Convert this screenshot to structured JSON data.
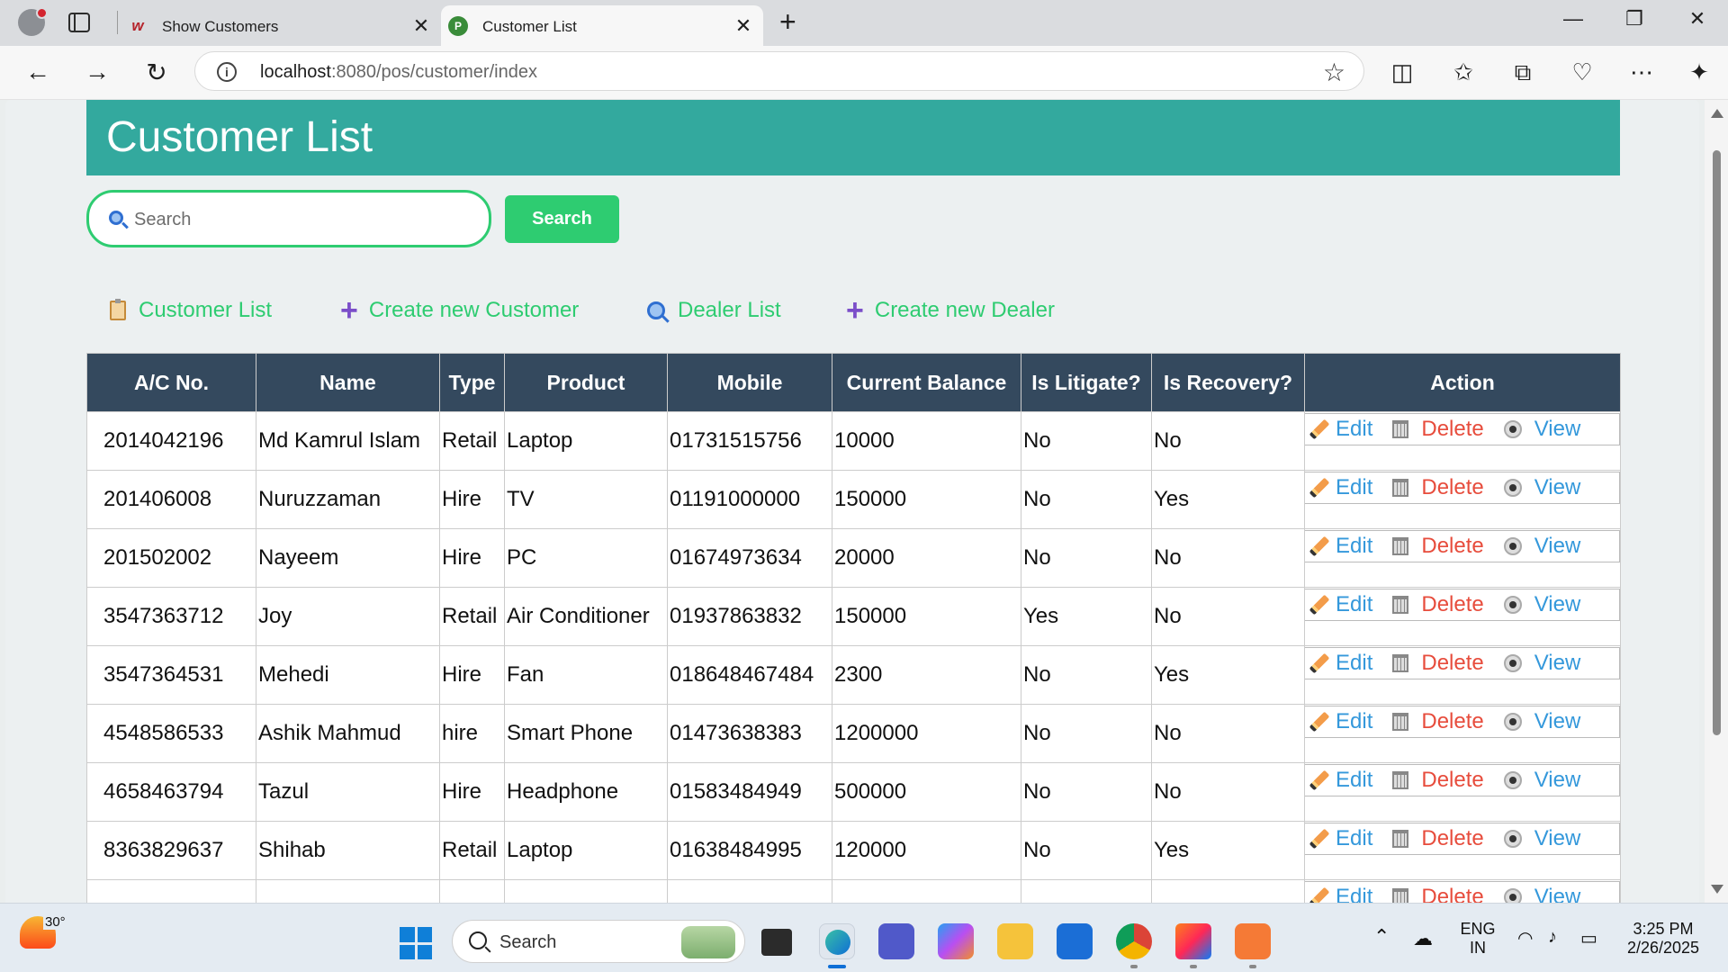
{
  "browser": {
    "tabs": [
      {
        "title": "Show Customers",
        "icon": "w-logo-icon",
        "active": false
      },
      {
        "title": "Customer List",
        "icon": "pos-logo-icon",
        "active": true
      }
    ],
    "url_host": "localhost",
    "url_path": ":8080/pos/customer/index"
  },
  "page": {
    "title": "Customer List",
    "search": {
      "placeholder": "Search",
      "button": "Search"
    },
    "nav": {
      "customer_list": "Customer List",
      "create_customer": "Create new Customer",
      "dealer_list": "Dealer List",
      "create_dealer": "Create new Dealer"
    },
    "colors": {
      "header": "#33a99e",
      "accent": "#2ecc71",
      "table_header": "#34495e",
      "edit": "#3498db",
      "delete": "#e74c3c"
    }
  },
  "table": {
    "columns": [
      "A/C No.",
      "Name",
      "Type",
      "Product",
      "Mobile",
      "Current Balance",
      "Is Litigate?",
      "Is Recovery?",
      "Action"
    ],
    "actions": {
      "edit": "Edit",
      "delete": "Delete",
      "view": "View"
    },
    "rows": [
      [
        "2014042196",
        "Md Kamrul Islam",
        "Retail",
        "Laptop",
        "01731515756",
        "10000",
        "No",
        "No"
      ],
      [
        "201406008",
        "Nuruzzaman",
        "Hire",
        "TV",
        "01191000000",
        "150000",
        "No",
        "Yes"
      ],
      [
        "201502002",
        "Nayeem",
        "Hire",
        "PC",
        "01674973634",
        "20000",
        "No",
        "No"
      ],
      [
        "3547363712",
        "Joy",
        "Retail",
        "Air Conditioner",
        "01937863832",
        "150000",
        "Yes",
        "No"
      ],
      [
        "3547364531",
        "Mehedi",
        "Hire",
        "Fan",
        "018648467484",
        "2300",
        "No",
        "Yes"
      ],
      [
        "4548586533",
        "Ashik Mahmud",
        "hire",
        "Smart Phone",
        "01473638383",
        "1200000",
        "No",
        "No"
      ],
      [
        "4658463794",
        "Tazul",
        "Hire",
        "Headphone",
        "01583484949",
        "500000",
        "No",
        "No"
      ],
      [
        "8363829637",
        "Shihab",
        "Retail",
        "Laptop",
        "01638484995",
        "120000",
        "No",
        "Yes"
      ],
      [
        "",
        "",
        "",
        "",
        "",
        "",
        "",
        ""
      ]
    ]
  },
  "taskbar": {
    "temperature": "30°",
    "search_placeholder": "Search",
    "language": "ENG",
    "region": "IN",
    "time": "3:25 PM",
    "date": "2/26/2025"
  }
}
